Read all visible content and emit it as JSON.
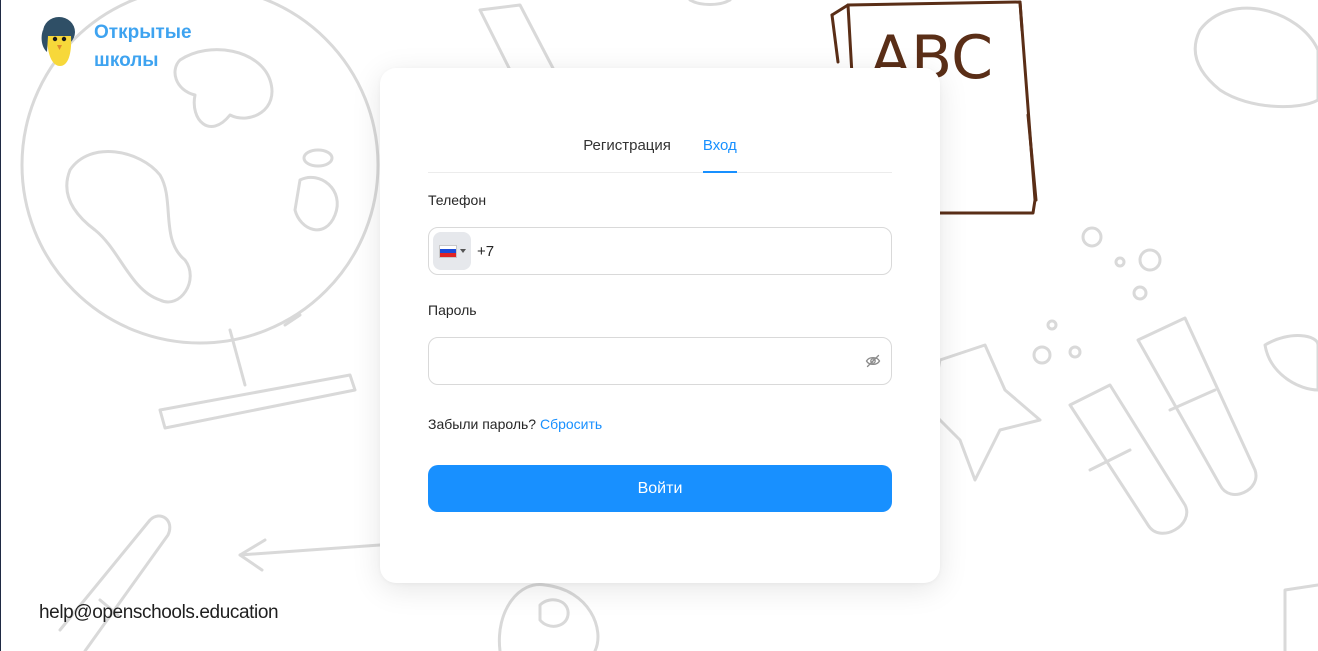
{
  "brand": {
    "name_line1": "Открытые",
    "name_line2": "школы",
    "logo_icon": "penguin-logo-icon",
    "accent_color": "#3ea3f0"
  },
  "footer": {
    "email": "help@openschools.education"
  },
  "tabs": [
    {
      "label": "Регистрация",
      "active": false
    },
    {
      "label": "Вход",
      "active": true
    }
  ],
  "form": {
    "phone_label": "Телефон",
    "phone_country": "RU",
    "phone_value": "+7",
    "password_label": "Пароль",
    "password_value": "",
    "password_visibility_icon": "eye-off-icon",
    "forgot_text": "Забыли пароль?",
    "reset_link": "Сбросить",
    "submit_label": "Войти",
    "primary_color": "#1890ff"
  },
  "decor": {
    "abc_book_text": "ABC"
  }
}
